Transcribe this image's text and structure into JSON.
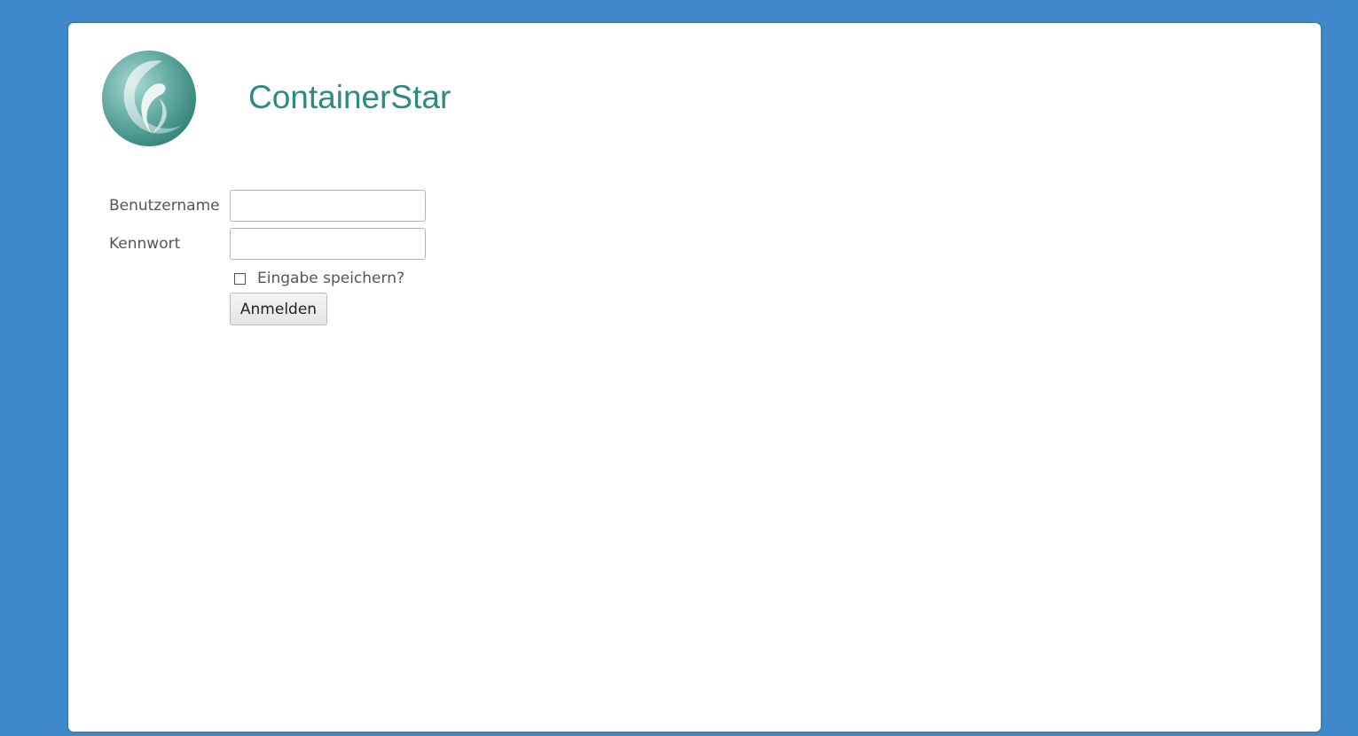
{
  "app": {
    "title": "ContainerStar",
    "logo_icon": "containerstar-logo-icon"
  },
  "colors": {
    "background": "#3f88cb",
    "panel": "#ffffff",
    "title": "#2e8a80",
    "label": "#555555"
  },
  "login": {
    "username_label": "Benutzername",
    "username_value": "",
    "password_label": "Kennwort",
    "password_value": "",
    "remember_label": "Eingabe speichern?",
    "remember_checked": false,
    "submit_label": "Anmelden"
  }
}
